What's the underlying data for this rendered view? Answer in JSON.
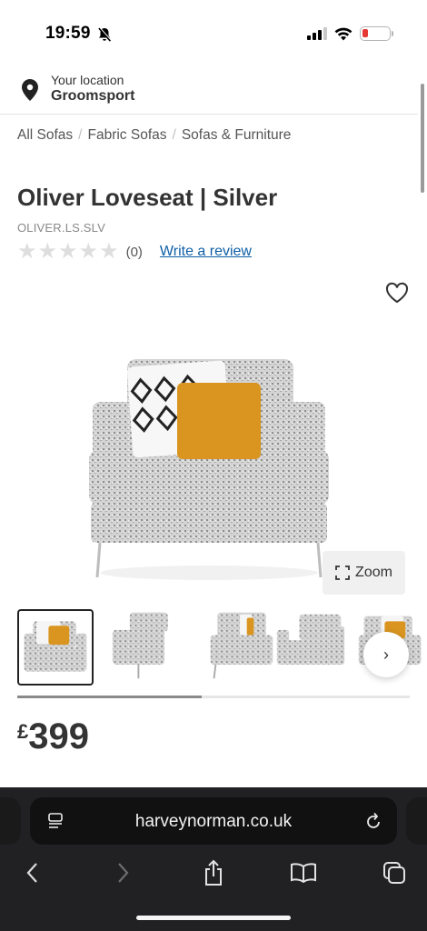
{
  "status": {
    "time": "19:59"
  },
  "location": {
    "label": "Your location",
    "town": "Groomsport"
  },
  "breadcrumb": [
    "All Sofas",
    "Fabric Sofas",
    "Sofas & Furniture"
  ],
  "product": {
    "title": "Oliver Loveseat | Silver",
    "sku": "OLIVER.LS.SLV",
    "rating": 0,
    "review_count": "(0)",
    "write_review": "Write a review",
    "price_currency": "£",
    "price_amount": "399"
  },
  "gallery": {
    "zoom_label": "Zoom",
    "thumbnail_count": 5,
    "active_index": 0,
    "scroll_progress": 0.47
  },
  "browser": {
    "url": "harveynorman.co.uk"
  },
  "colors": {
    "link": "#0d5fa6",
    "cushion": "#d9951f",
    "fabric": "#c9c9c9",
    "chrome": "#212123"
  }
}
